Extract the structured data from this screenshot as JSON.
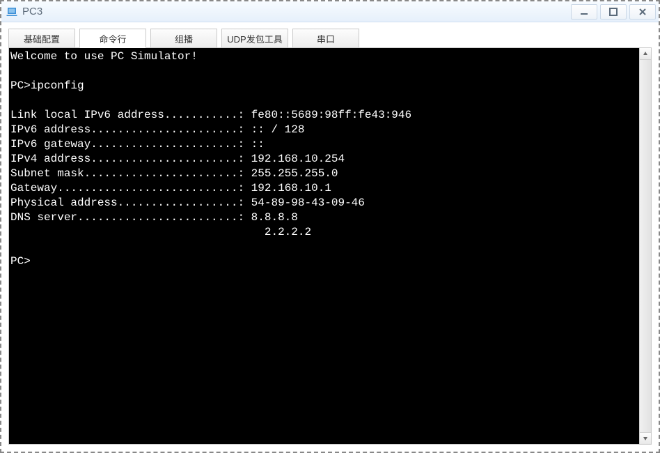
{
  "window": {
    "title": "PC3"
  },
  "tabs": [
    {
      "label": "基础配置",
      "active": false
    },
    {
      "label": "命令行",
      "active": true
    },
    {
      "label": "组播",
      "active": false
    },
    {
      "label": "UDP发包工具",
      "active": false
    },
    {
      "label": "串口",
      "active": false
    }
  ],
  "terminal": {
    "welcome": "Welcome to use PC Simulator!",
    "prompt": "PC>",
    "command": "ipconfig",
    "lines": [
      {
        "label": "Link local IPv6 address",
        "dots": "...........",
        "value": "fe80::5689:98ff:fe43:946"
      },
      {
        "label": "IPv6 address",
        "dots": "......................",
        "value": ":: / 128"
      },
      {
        "label": "IPv6 gateway",
        "dots": "......................",
        "value": "::"
      },
      {
        "label": "IPv4 address",
        "dots": "......................",
        "value": "192.168.10.254"
      },
      {
        "label": "Subnet mask",
        "dots": ".......................",
        "value": "255.255.255.0"
      },
      {
        "label": "Gateway",
        "dots": "...........................",
        "value": "192.168.10.1"
      },
      {
        "label": "Physical address",
        "dots": "..................",
        "value": "54-89-98-43-09-46"
      },
      {
        "label": "DNS server",
        "dots": "........................",
        "value": "8.8.8.8"
      }
    ],
    "dns_secondary_pad": "                                      ",
    "dns_secondary": "2.2.2.2"
  }
}
